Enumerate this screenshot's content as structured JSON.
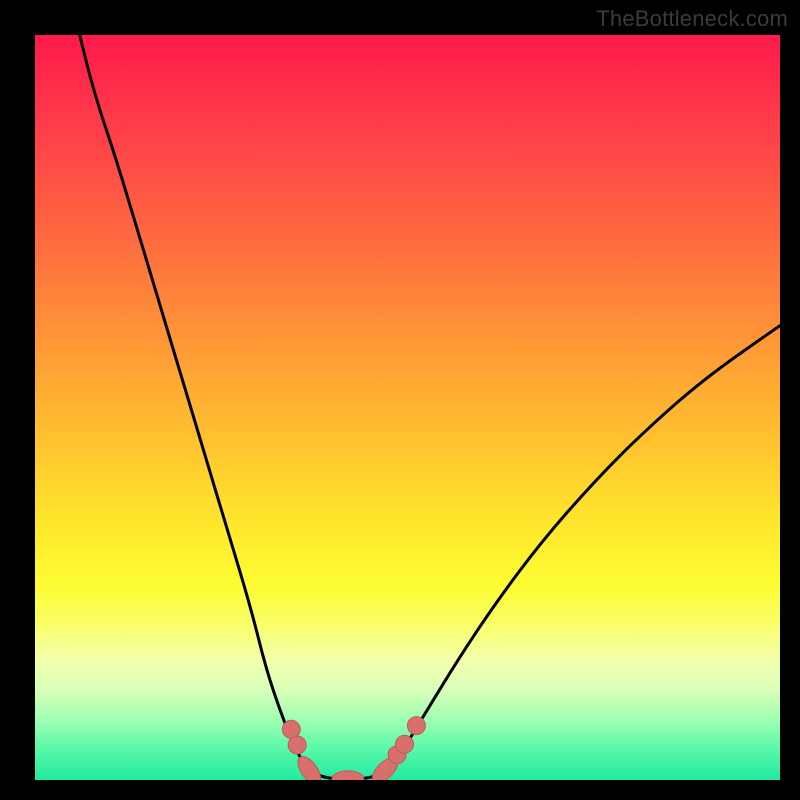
{
  "watermark": "TheBottleneck.com",
  "colors": {
    "frame": "#000000",
    "curve_stroke": "#000000",
    "marker_fill": "#d76f6c",
    "marker_stroke": "#c45a58"
  },
  "chart_data": {
    "type": "line",
    "title": "",
    "xlabel": "",
    "ylabel": "",
    "xlim": [
      0,
      100
    ],
    "ylim": [
      0,
      100
    ],
    "grid": false,
    "series": [
      {
        "name": "left-branch",
        "x": [
          6,
          8,
          11,
          14,
          17,
          20,
          23,
          26,
          29,
          31,
          33,
          34.8,
          36.2,
          37.2
        ],
        "y": [
          100,
          92,
          83,
          73,
          63,
          53,
          43,
          33,
          23,
          15,
          9,
          4.5,
          2,
          1
        ]
      },
      {
        "name": "valley-floor",
        "x": [
          37.2,
          39,
          41,
          43,
          45,
          46.8
        ],
        "y": [
          1,
          0.3,
          0.1,
          0.1,
          0.3,
          1
        ]
      },
      {
        "name": "right-branch",
        "x": [
          46.8,
          48,
          50,
          53,
          57,
          62,
          68,
          75,
          82,
          90,
          100
        ],
        "y": [
          1,
          2.2,
          5,
          10,
          16.5,
          24,
          32,
          40,
          47,
          54,
          61
        ]
      }
    ],
    "markers": {
      "name": "highlighted-points",
      "shape": "rounded-capsule",
      "points": [
        {
          "x": 34.4,
          "y": 6.8
        },
        {
          "x": 35.2,
          "y": 4.7
        },
        {
          "x": 36.8,
          "y": 1.3,
          "wide": true
        },
        {
          "x": 42.0,
          "y": 0.15,
          "wide": true
        },
        {
          "x": 47.0,
          "y": 1.3,
          "wide": true
        },
        {
          "x": 48.6,
          "y": 3.4
        },
        {
          "x": 49.6,
          "y": 4.8
        },
        {
          "x": 51.2,
          "y": 7.3
        }
      ]
    }
  }
}
